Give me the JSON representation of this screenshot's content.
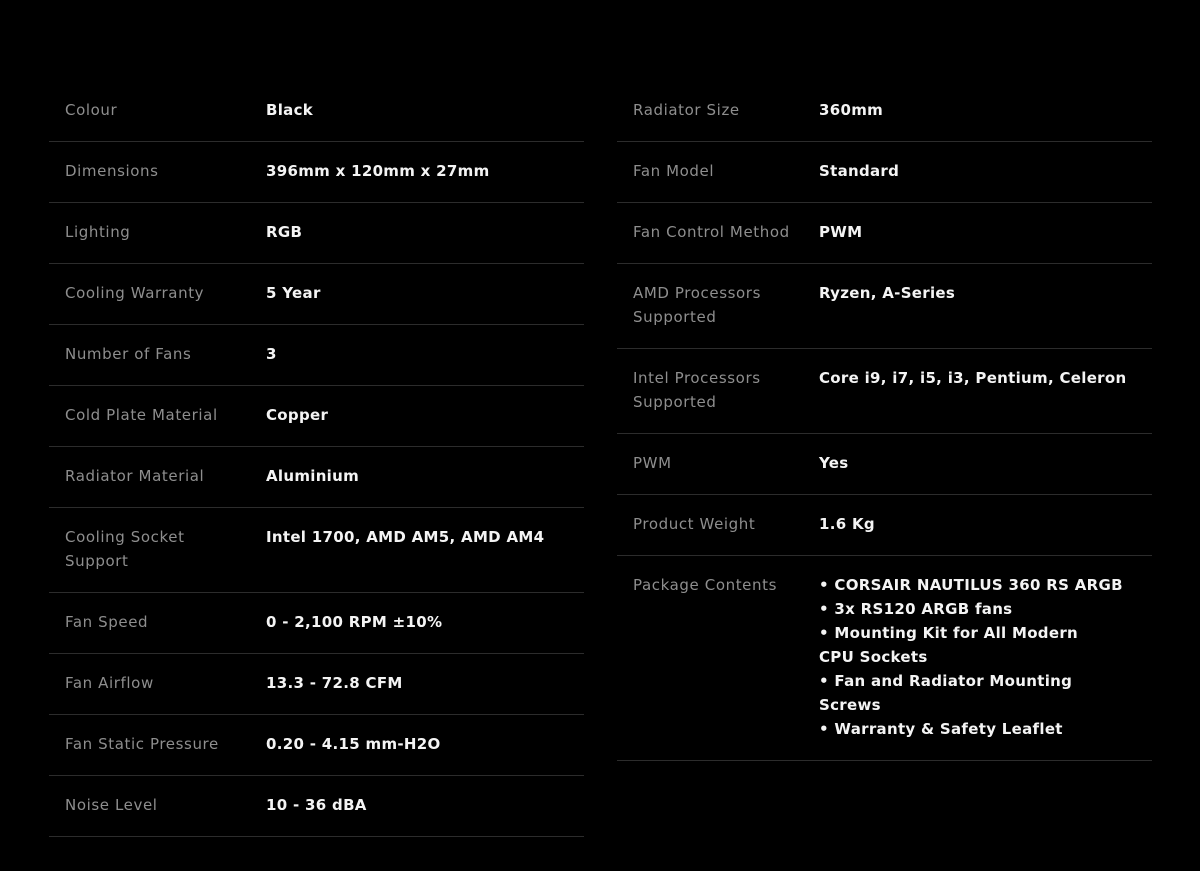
{
  "left_specs": [
    {
      "label": "Colour",
      "value": "Black"
    },
    {
      "label": "Dimensions",
      "value": "396mm x 120mm x 27mm"
    },
    {
      "label": "Lighting",
      "value": "RGB"
    },
    {
      "label": "Cooling Warranty",
      "value": "5 Year"
    },
    {
      "label": "Number of Fans",
      "value": "3"
    },
    {
      "label": "Cold Plate Material",
      "value": "Copper"
    },
    {
      "label": "Radiator Material",
      "value": "Aluminium"
    },
    {
      "label": "Cooling Socket\nSupport",
      "value": "Intel 1700, AMD AM5, AMD AM4"
    },
    {
      "label": "Fan Speed",
      "value": "0 - 2,100 RPM ±10%"
    },
    {
      "label": "Fan Airflow",
      "value": "13.3 - 72.8 CFM"
    },
    {
      "label": "Fan Static Pressure",
      "value": "0.20 - 4.15 mm-H2O"
    },
    {
      "label": "Noise Level",
      "value": "10 - 36 dBA"
    }
  ],
  "right_specs": [
    {
      "label": "Radiator Size",
      "value": "360mm"
    },
    {
      "label": "Fan Model",
      "value": "Standard"
    },
    {
      "label": "Fan Control Method",
      "value": "PWM"
    },
    {
      "label": "AMD Processors\nSupported",
      "value": "Ryzen, A-Series"
    },
    {
      "label": "Intel Processors\nSupported",
      "value": "Core i9, i7, i5, i3, Pentium, Celeron"
    },
    {
      "label": "PWM",
      "value": "Yes"
    },
    {
      "label": "Product Weight",
      "value": "1.6 Kg"
    },
    {
      "label": "Package Contents",
      "value": "• CORSAIR NAUTILUS 360 RS ARGB\n• 3x RS120 ARGB fans\n• Mounting Kit for All Modern\nCPU Sockets\n• Fan and Radiator Mounting Screws\n• Warranty & Safety Leaflet"
    }
  ]
}
